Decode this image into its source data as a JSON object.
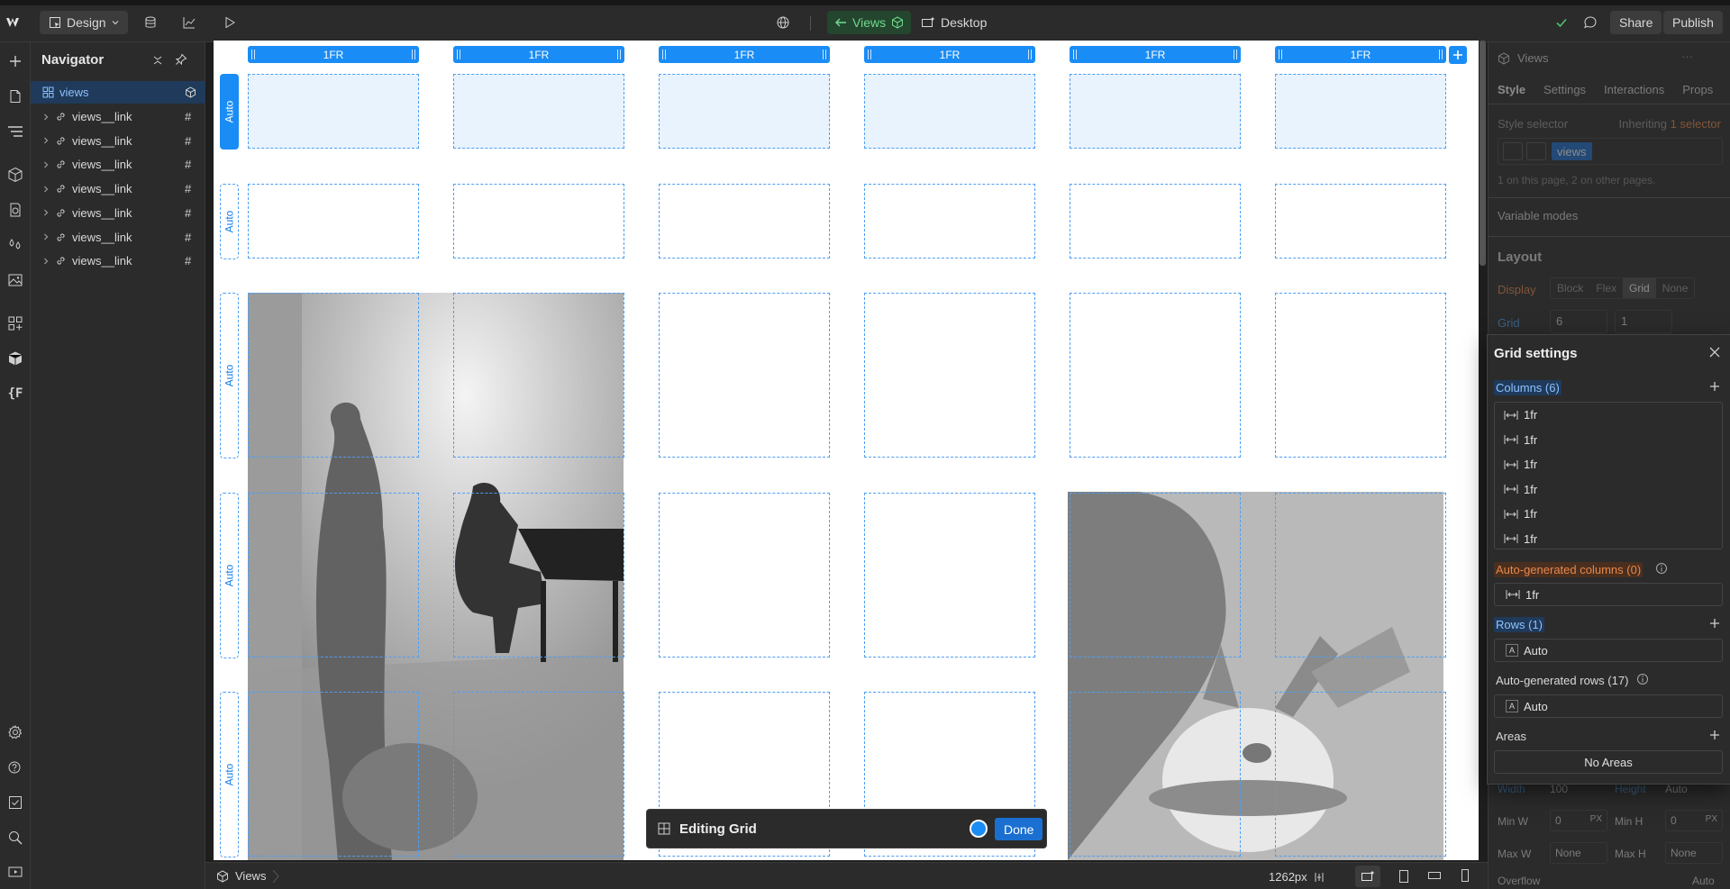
{
  "topbar": {
    "mode_label": "Design",
    "view_chip": "Views",
    "breakpoint": "Desktop",
    "share_label": "Share",
    "publish_label": "Publish"
  },
  "navigator": {
    "title": "Navigator",
    "root": "views",
    "children": [
      "views__link",
      "views__link",
      "views__link",
      "views__link",
      "views__link",
      "views__link",
      "views__link"
    ]
  },
  "canvas": {
    "column_labels": [
      "1FR",
      "1FR",
      "1FR",
      "1FR",
      "1FR",
      "1FR"
    ],
    "row_labels": [
      "Auto",
      "Auto",
      "Auto",
      "Auto",
      "Auto"
    ]
  },
  "edit_bar": {
    "label": "Editing Grid",
    "done_label": "Done"
  },
  "statusbar": {
    "breadcrumb": "Views",
    "width_readout": "1262px"
  },
  "right_panel": {
    "element_name": "Views",
    "tabs": [
      "Style",
      "Settings",
      "Interactions",
      "Props"
    ],
    "style_selector_label": "Style selector",
    "inheriting_text": "Inheriting",
    "inheriting_count": "1 selector",
    "selector_chip": "views",
    "usage_text": "1 on this page, 2 on other pages.",
    "variable_modes": "Variable modes",
    "layout_title": "Layout",
    "display_label": "Display",
    "display_options": [
      "Block",
      "Flex",
      "Grid",
      "None"
    ],
    "grid_label": "Grid",
    "grid_columns": "6",
    "grid_rows": "1",
    "size_labels": {
      "width": "Width",
      "height": "Height",
      "width_val": "100",
      "height_val": "Auto",
      "min_w": "Min W",
      "min_h": "Min H",
      "min_w_val": "0",
      "min_h_val": "0",
      "max_w": "Max W",
      "max_h": "Max H",
      "max_w_val": "None",
      "max_h_val": "None",
      "unit": "PX",
      "overflow": "Overflow",
      "overflow_auto": "Auto"
    }
  },
  "grid_settings": {
    "title": "Grid settings",
    "columns_label": "Columns (6)",
    "columns": [
      "1fr",
      "1fr",
      "1fr",
      "1fr",
      "1fr",
      "1fr"
    ],
    "auto_columns_label": "Auto-generated columns (0)",
    "auto_column_value": "1fr",
    "rows_label": "Rows (1)",
    "row_value": "Auto",
    "auto_rows_label": "Auto-generated rows (17)",
    "auto_row_value": "Auto",
    "areas_label": "Areas",
    "areas_value": "No Areas"
  },
  "colors": {
    "accent": "#1a8cf5",
    "panel": "#2b2b2b",
    "canvas_bg": "#1e1e1e",
    "orange": "#e8874a",
    "green": "#49c46b"
  }
}
